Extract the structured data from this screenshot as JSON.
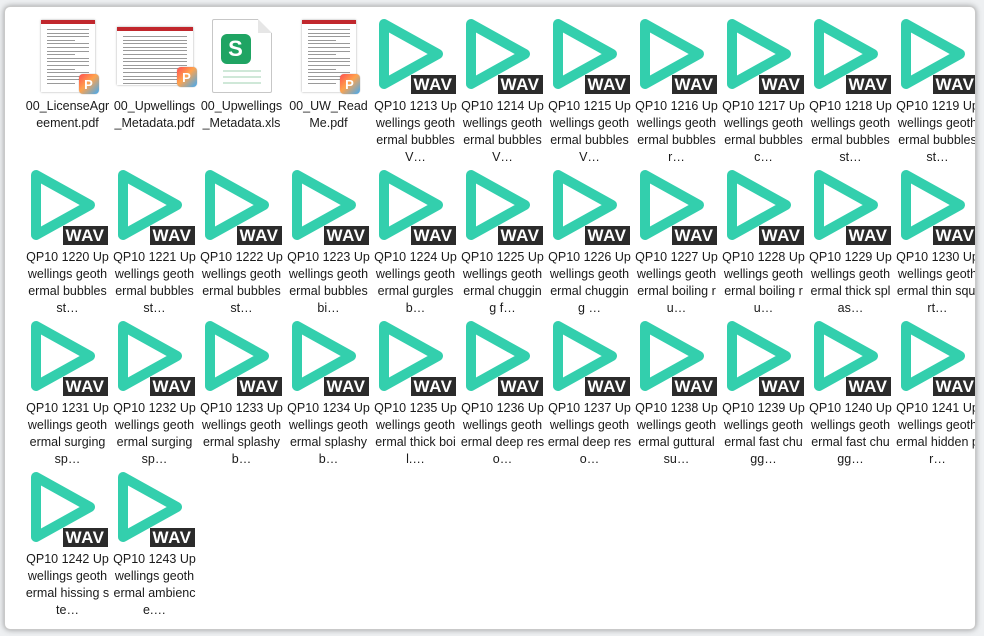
{
  "files": [
    {
      "type": "pdf",
      "variant": "doc",
      "name": "00_LicenseAgreement.pdf",
      "icon": "pdf-document-icon"
    },
    {
      "type": "pdf",
      "variant": "doc",
      "name": "00_Upwellings_Metadata.pdf",
      "icon": "pdf-document-icon"
    },
    {
      "type": "xls",
      "variant": "xls",
      "name": "00_Upwellings_Metadata.xls",
      "icon": "spreadsheet-icon"
    },
    {
      "type": "pdf",
      "variant": "doc",
      "name": "00_UW_ReadMe.pdf",
      "icon": "pdf-document-icon"
    },
    {
      "type": "wav",
      "name": "QP10 1213 Upwellings geothermal bubbles V…",
      "icon": "wav-play-icon"
    },
    {
      "type": "wav",
      "name": "QP10 1214 Upwellings geothermal bubbles V…",
      "icon": "wav-play-icon"
    },
    {
      "type": "wav",
      "name": "QP10 1215 Upwellings geothermal bubbles V…",
      "icon": "wav-play-icon"
    },
    {
      "type": "wav",
      "name": "QP10 1216 Upwellings geothermal bubbles r…",
      "icon": "wav-play-icon"
    },
    {
      "type": "wav",
      "name": "QP10 1217 Upwellings geothermal bubbles c…",
      "icon": "wav-play-icon"
    },
    {
      "type": "wav",
      "name": "QP10 1218 Upwellings geothermal bubbles st…",
      "icon": "wav-play-icon"
    },
    {
      "type": "wav",
      "name": "QP10 1219 Upwellings geothermal bubbles st…",
      "icon": "wav-play-icon"
    },
    {
      "type": "wav",
      "name": "QP10 1220 Upwellings geothermal bubbles st…",
      "icon": "wav-play-icon"
    },
    {
      "type": "wav",
      "name": "QP10 1221 Upwellings geothermal bubbles st…",
      "icon": "wav-play-icon"
    },
    {
      "type": "wav",
      "name": "QP10 1222 Upwellings geothermal bubbles st…",
      "icon": "wav-play-icon"
    },
    {
      "type": "wav",
      "name": "QP10 1223 Upwellings geothermal bubbles bi…",
      "icon": "wav-play-icon"
    },
    {
      "type": "wav",
      "name": "QP10 1224 Upwellings geothermal gurgles b…",
      "icon": "wav-play-icon"
    },
    {
      "type": "wav",
      "name": "QP10 1225 Upwellings geothermal chugging f…",
      "icon": "wav-play-icon"
    },
    {
      "type": "wav",
      "name": "QP10 1226 Upwellings geothermal chugging …",
      "icon": "wav-play-icon"
    },
    {
      "type": "wav",
      "name": "QP10 1227 Upwellings geothermal boiling ru…",
      "icon": "wav-play-icon"
    },
    {
      "type": "wav",
      "name": "QP10 1228 Upwellings geothermal boiling ru…",
      "icon": "wav-play-icon"
    },
    {
      "type": "wav",
      "name": "QP10 1229 Upwellings geothermal thick splas…",
      "icon": "wav-play-icon"
    },
    {
      "type": "wav",
      "name": "QP10 1230 Upwellings geothermal thin squirt…",
      "icon": "wav-play-icon"
    },
    {
      "type": "wav",
      "name": "QP10 1231 Upwellings geothermal surging sp…",
      "icon": "wav-play-icon"
    },
    {
      "type": "wav",
      "name": "QP10 1232 Upwellings geothermal surging sp…",
      "icon": "wav-play-icon"
    },
    {
      "type": "wav",
      "name": "QP10 1233 Upwellings geothermal splashy b…",
      "icon": "wav-play-icon"
    },
    {
      "type": "wav",
      "name": "QP10 1234 Upwellings geothermal splashy b…",
      "icon": "wav-play-icon"
    },
    {
      "type": "wav",
      "name": "QP10 1235 Upwellings geothermal thick boil.…",
      "icon": "wav-play-icon"
    },
    {
      "type": "wav",
      "name": "QP10 1236 Upwellings geothermal deep reso…",
      "icon": "wav-play-icon"
    },
    {
      "type": "wav",
      "name": "QP10 1237 Upwellings geothermal deep reso…",
      "icon": "wav-play-icon"
    },
    {
      "type": "wav",
      "name": "QP10 1238 Upwellings geothermal guttural su…",
      "icon": "wav-play-icon"
    },
    {
      "type": "wav",
      "name": "QP10 1239 Upwellings geothermal fast chugg…",
      "icon": "wav-play-icon"
    },
    {
      "type": "wav",
      "name": "QP10 1240 Upwellings geothermal fast chugg…",
      "icon": "wav-play-icon"
    },
    {
      "type": "wav",
      "name": "QP10 1241 Upwellings geothermal hidden pr…",
      "icon": "wav-play-icon"
    },
    {
      "type": "wav",
      "name": "QP10 1242 Upwellings geothermal hissing ste…",
      "icon": "wav-play-icon"
    },
    {
      "type": "wav",
      "name": "QP10 1243 Upwellings geothermal ambience.…",
      "icon": "wav-play-icon"
    }
  ],
  "labels": {
    "wav_badge": "WAV",
    "pdf_badge": "P",
    "xls_badge": "S",
    "pdf_header": "PDF"
  },
  "colors": {
    "wav_accent": "#33cfad",
    "pdf_red": "#c1272d",
    "xls_green": "#1fa463"
  }
}
